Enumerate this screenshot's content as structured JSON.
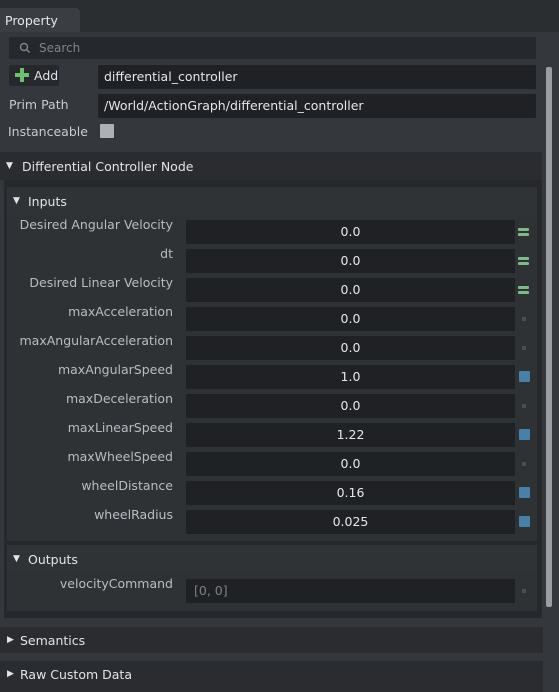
{
  "window": {
    "tab_label": "Property"
  },
  "search": {
    "placeholder": "Search"
  },
  "header": {
    "add_label": "Add",
    "name_value": "differential_controller",
    "prim_path_label": "Prim Path",
    "prim_path_value": "/World/ActionGraph/differential_controller",
    "instanceable_label": "Instanceable"
  },
  "node_section": {
    "title": "Differential Controller Node",
    "inputs_title": "Inputs",
    "inputs": [
      {
        "label": "Desired Angular Velocity",
        "value": "0.0",
        "marker": "connection"
      },
      {
        "label": "dt",
        "value": "0.0",
        "marker": "connection"
      },
      {
        "label": "Desired Linear Velocity",
        "value": "0.0",
        "marker": "connection"
      },
      {
        "label": "maxAcceleration",
        "value": "0.0",
        "marker": "default"
      },
      {
        "label": "maxAngularAcceleration",
        "value": "0.0",
        "marker": "default"
      },
      {
        "label": "maxAngularSpeed",
        "value": "1.0",
        "marker": "authored"
      },
      {
        "label": "maxDeceleration",
        "value": "0.0",
        "marker": "default"
      },
      {
        "label": "maxLinearSpeed",
        "value": "1.22",
        "marker": "authored"
      },
      {
        "label": "maxWheelSpeed",
        "value": "0.0",
        "marker": "default"
      },
      {
        "label": "wheelDistance",
        "value": "0.16",
        "marker": "authored"
      },
      {
        "label": "wheelRadius",
        "value": "0.025",
        "marker": "authored"
      }
    ],
    "outputs_title": "Outputs",
    "outputs": [
      {
        "label": "velocityCommand",
        "value": "[0, 0]",
        "marker": "default"
      }
    ]
  },
  "sections": {
    "semantics_title": "Semantics",
    "cut_title": "Raw Custom Data"
  },
  "colors": {
    "accent_green": "#7fb98a",
    "accent_blue": "#4a7fa8",
    "panel": "#34373b"
  }
}
